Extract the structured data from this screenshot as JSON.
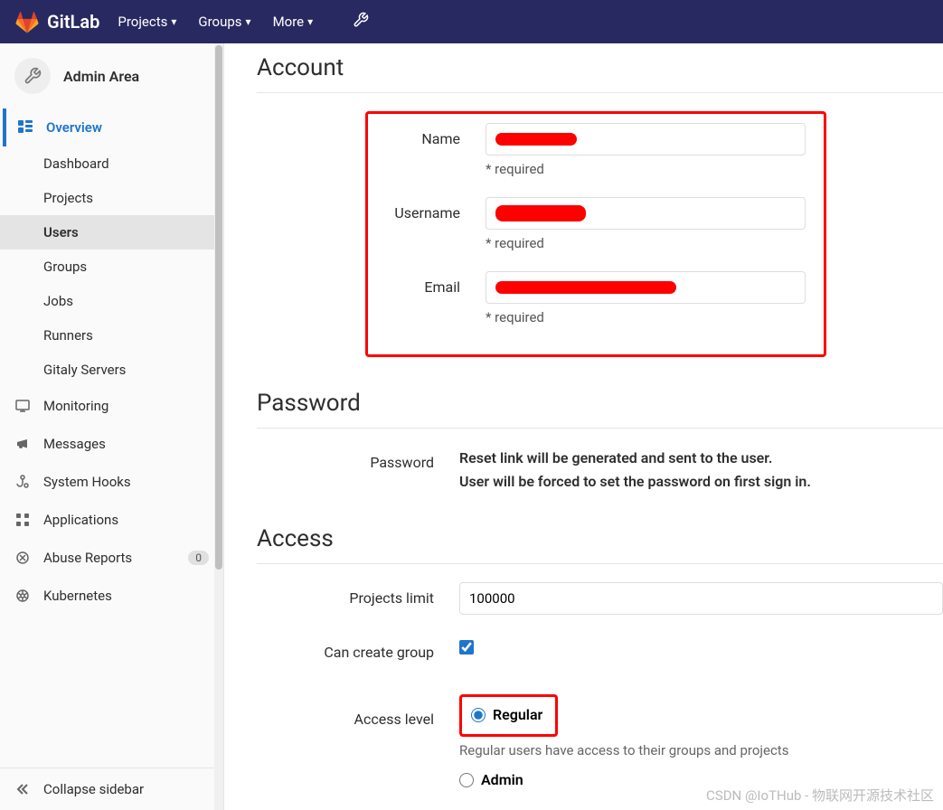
{
  "nav": {
    "brand": "GitLab",
    "items": [
      "Projects",
      "Groups",
      "More"
    ]
  },
  "sidebar": {
    "title": "Admin Area",
    "overview": {
      "label": "Overview",
      "children": [
        "Dashboard",
        "Projects",
        "Users",
        "Groups",
        "Jobs",
        "Runners",
        "Gitaly Servers"
      ]
    },
    "items": [
      {
        "label": "Monitoring"
      },
      {
        "label": "Messages"
      },
      {
        "label": "System Hooks"
      },
      {
        "label": "Applications"
      },
      {
        "label": "Abuse Reports",
        "badge": "0"
      },
      {
        "label": "Kubernetes"
      }
    ],
    "collapse": "Collapse sidebar"
  },
  "account": {
    "title": "Account",
    "name_label": "Name",
    "username_label": "Username",
    "email_label": "Email",
    "required": "* required"
  },
  "password": {
    "title": "Password",
    "label": "Password",
    "desc1": "Reset link will be generated and sent to the user.",
    "desc2": "User will be forced to set the password on first sign in."
  },
  "access": {
    "title": "Access",
    "projects_limit_label": "Projects limit",
    "projects_limit_value": "100000",
    "can_create_group_label": "Can create group",
    "can_create_group_checked": true,
    "access_level_label": "Access level",
    "regular_label": "Regular",
    "regular_desc": "Regular users have access to their groups and projects",
    "admin_label": "Admin"
  },
  "watermark": "CSDN @IoTHub - 物联网开源技术社区"
}
